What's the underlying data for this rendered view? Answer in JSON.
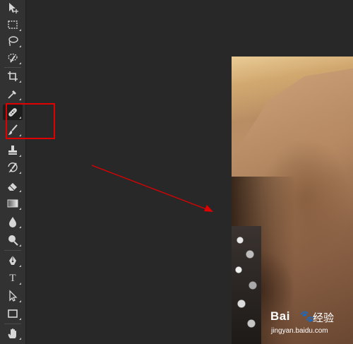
{
  "toolbar": {
    "tools": [
      {
        "icon": "move-tool-icon",
        "has_submenu": false
      },
      {
        "icon": "rectangular-marquee-icon",
        "has_submenu": true
      },
      {
        "icon": "lasso-icon",
        "has_submenu": true
      },
      {
        "icon": "quick-selection-icon",
        "has_submenu": true
      },
      {
        "icon": "crop-icon",
        "has_submenu": true
      },
      {
        "icon": "eyedropper-icon",
        "has_submenu": true
      },
      {
        "icon": "spot-healing-brush-icon",
        "has_submenu": true,
        "active": true
      },
      {
        "icon": "brush-icon",
        "has_submenu": true
      },
      {
        "icon": "clone-stamp-icon",
        "has_submenu": true
      },
      {
        "icon": "history-brush-icon",
        "has_submenu": true
      },
      {
        "icon": "eraser-icon",
        "has_submenu": true
      },
      {
        "icon": "gradient-icon",
        "has_submenu": true
      },
      {
        "icon": "blur-icon",
        "has_submenu": true
      },
      {
        "icon": "dodge-icon",
        "has_submenu": true
      },
      {
        "icon": "pen-icon",
        "has_submenu": true
      },
      {
        "icon": "type-icon",
        "has_submenu": true,
        "glyph": "T"
      },
      {
        "icon": "path-selection-icon",
        "has_submenu": true
      },
      {
        "icon": "rectangle-shape-icon",
        "has_submenu": true
      },
      {
        "icon": "hand-icon",
        "has_submenu": true
      }
    ]
  },
  "annotation": {
    "box_color": "#e00000",
    "arrow_color": "#e00000"
  },
  "watermark": {
    "logo": "Bai",
    "paw": "🐾",
    "cn": "经验",
    "url": "jingyan.baidu.com"
  },
  "colors": {
    "app_background": "#282828",
    "toolbar_background": "#323232",
    "icon_color": "#d6d6d6"
  }
}
